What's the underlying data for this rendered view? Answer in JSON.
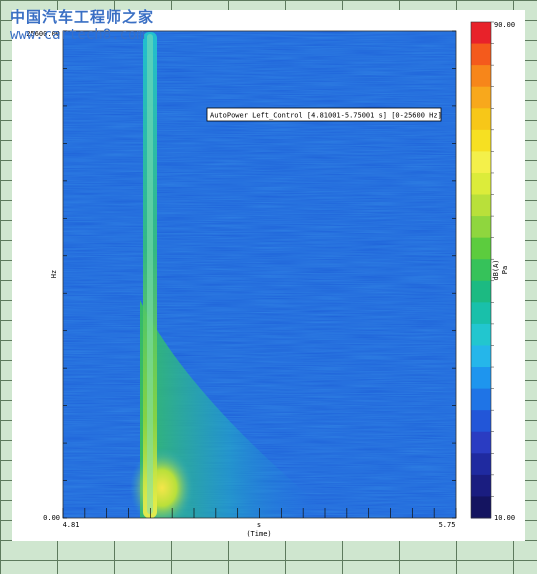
{
  "watermark": {
    "chinese": "中国汽车工程师之家",
    "url": "www.cartech8.com"
  },
  "chart_data": {
    "type": "heatmap",
    "kind": "spectrogram",
    "title": "AutoPower Left_Control [4.81001-5.75001 s] [0-25600 Hz]",
    "xlabel_unit": "s",
    "xlabel": "(Time)",
    "ylabel": "Hz",
    "xlim": [
      4.81,
      5.75
    ],
    "ylim": [
      0,
      25600
    ],
    "x_tick_labels": [
      "4.81",
      "5.75"
    ],
    "y_tick_labels": [
      "0.00",
      "25600.00"
    ],
    "colorbar": {
      "label": "dB(A)",
      "unit": "Pa",
      "range": [
        10,
        90
      ],
      "tick_labels": [
        "90.00",
        "10.00"
      ],
      "colors": [
        "#e8222a",
        "#f45a1c",
        "#f7861a",
        "#f8a81c",
        "#f7c718",
        "#f6e022",
        "#f4f04a",
        "#dcec3a",
        "#b9e03a",
        "#8fd63e",
        "#5ccc3e",
        "#36c25a",
        "#1cba82",
        "#19c0aa",
        "#22c6cf",
        "#25b6ea",
        "#1e95ee",
        "#1f74e6",
        "#2256d8",
        "#2a3cc2",
        "#1f2aa0",
        "#1a1d80",
        "#141460"
      ]
    },
    "features": {
      "background_level_db": 40,
      "ridge_time_s": 4.92,
      "ridge_level_db_high_freq": 55,
      "ridge_level_db_low_freq": 70,
      "low_freq_hotspot_level_db": 72,
      "decay_note": "energy spreads and decays toward later times at low frequency"
    },
    "grid": false,
    "legend": "colorbar-right"
  }
}
